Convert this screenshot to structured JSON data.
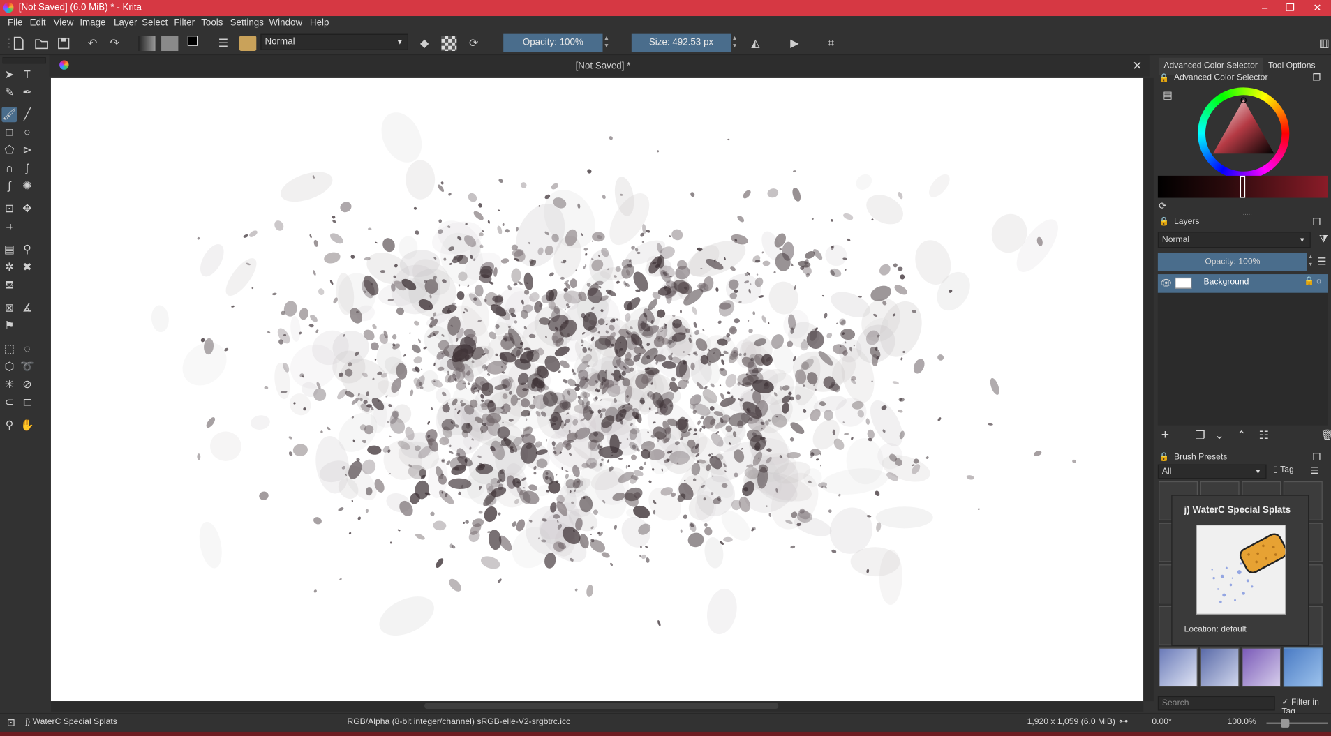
{
  "window": {
    "title": "[Not Saved]  (6.0 MiB)  * - Krita",
    "minimize": "–",
    "restore": "❐",
    "close": "✕"
  },
  "menu": [
    "File",
    "Edit",
    "View",
    "Image",
    "Layer",
    "Select",
    "Filter",
    "Tools",
    "Settings",
    "Window",
    "Help"
  ],
  "toolbar": {
    "blend_mode": "Normal",
    "opacity": "Opacity: 100%",
    "size": "Size: 492.53 px"
  },
  "document": {
    "tab_title": "[Not Saved]  *"
  },
  "dock": {
    "tab_color_selector": "Advanced Color Selector",
    "tab_tool_options": "Tool Options",
    "color_selector_title": "Advanced Color Selector",
    "layers_title": "Layers",
    "layers_blend": "Normal",
    "layers_opacity": "Opacity:  100%",
    "layer_name": "Background",
    "brush_presets_title": "Brush Presets",
    "brush_filter": "All",
    "tag_label": "Tag",
    "search_placeholder": "Search",
    "filter_in_tag": "Filter in Tag"
  },
  "tooltip": {
    "title": "j) WaterC Special Splats",
    "location": "Location: default"
  },
  "status": {
    "brush": "j) WaterC Special Splats",
    "color_space": "RGB/Alpha (8-bit integer/channel)  sRGB-elle-V2-srgbtrc.icc",
    "dimensions": "1,920 x 1,059 (6.0 MiB)",
    "rotation": "0.00°",
    "zoom": "100.0%"
  },
  "colors": {
    "titlebar": "#d63843",
    "accent": "#4a6d8c",
    "panel": "#323232"
  }
}
